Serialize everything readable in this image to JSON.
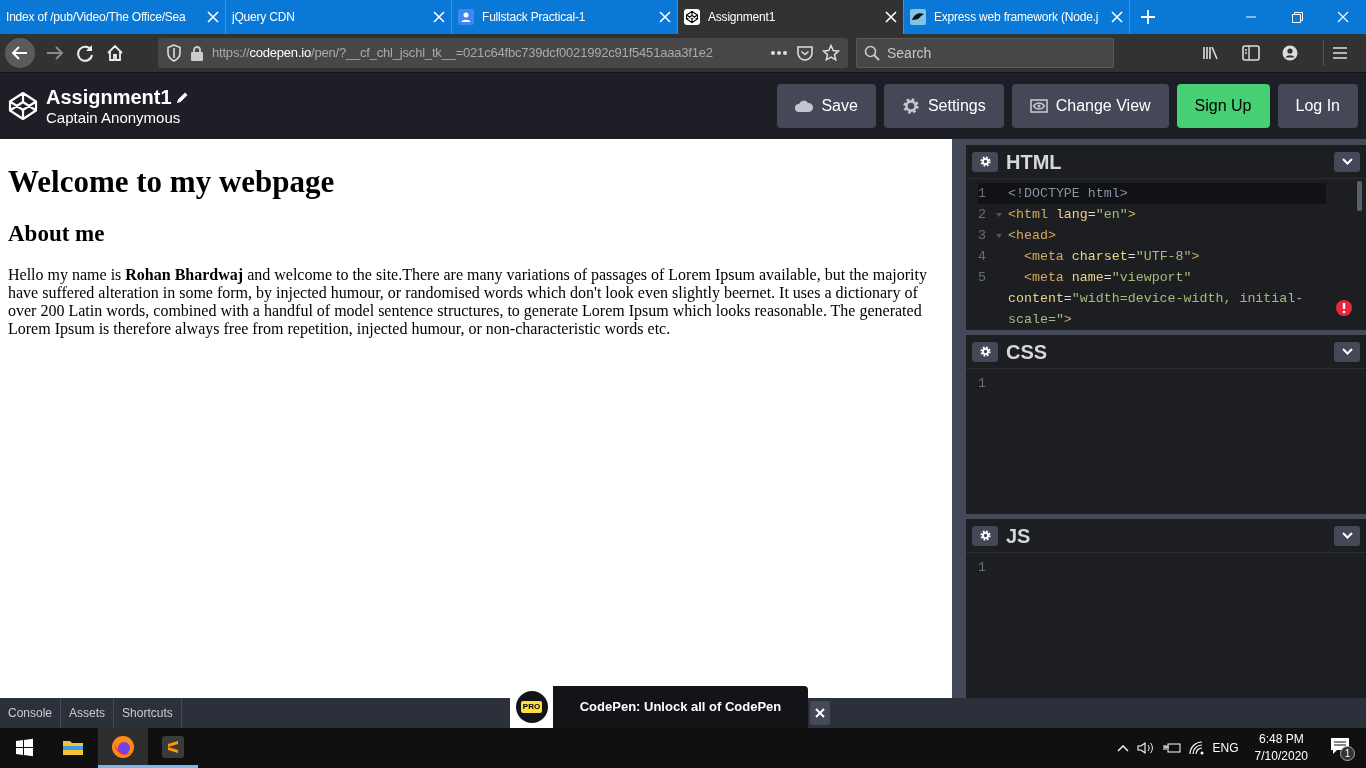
{
  "browser_tabs": [
    {
      "kind": "plain",
      "title": "Index of /pub/Video/The Office/Sea",
      "selected": false
    },
    {
      "kind": "plain",
      "title": "jQuery CDN",
      "selected": false
    },
    {
      "kind": "classroom",
      "title": "Fullstack Practical-1",
      "selected": false
    },
    {
      "kind": "codepen",
      "title": "Assignment1",
      "selected": true
    },
    {
      "kind": "express",
      "title": "Express web framework (Node.j",
      "selected": false
    }
  ],
  "address_bar": {
    "scheme": "https://",
    "domain": "codepen.io",
    "path": "/pen/?__cf_chl_jschl_tk__=021c64fbc739dcf0021992c91f5451aaa3f1e2"
  },
  "search": {
    "placeholder": "Search"
  },
  "pen": {
    "title": "Assignment1",
    "author": "Captain Anonymous"
  },
  "header_buttons": [
    {
      "kind": "cloud",
      "label": "Save",
      "highlighted": false
    },
    {
      "kind": "gear",
      "label": "Settings",
      "highlighted": false
    },
    {
      "kind": "eye",
      "label": "Change View",
      "highlighted": false
    },
    {
      "kind": "none",
      "label": "Sign Up",
      "highlighted": true
    },
    {
      "kind": "none",
      "label": "Log In",
      "highlighted": false
    }
  ],
  "preview": {
    "heading": "Welcome to my webpage",
    "subheading": "About me",
    "paragraph": "Hello my name is **Rohan Bhardwaj** and welcome to the site.There are many variations of passages of Lorem Ipsum available, but the majority have suffered alteration in some form, by injected humour, or randomised words which don't look even slightly beernet. It uses a dictionary of over 200 Latin words, combined with a handful of model sentence structures, to generate Lorem Ipsum which looks reasonable. The generated Lorem Ipsum is therefore always free from repetition, injected humour, or non-characteristic words etc."
  },
  "editors": [
    {
      "title": "HTML",
      "error": true,
      "lines": [
        {
          "number": "1",
          "active": true,
          "foldable": false,
          "tokens": [
            {
              "kind": "doctype",
              "text": "<!DOCTYPE html>"
            }
          ]
        },
        {
          "number": "2",
          "active": false,
          "foldable": true,
          "tokens": [
            {
              "kind": "tag",
              "text": "<html"
            },
            {
              "kind": "attr",
              "text": "lang"
            },
            {
              "kind": "plain",
              "text": "="
            },
            {
              "kind": "value",
              "text": "\"en\""
            },
            {
              "kind": "tag",
              "text": ">"
            }
          ]
        },
        {
          "number": "3",
          "active": false,
          "foldable": true,
          "tokens": [
            {
              "kind": "tag",
              "text": "<head>"
            }
          ]
        },
        {
          "number": "4",
          "active": false,
          "foldable": false,
          "indented": true,
          "tokens": [
            {
              "kind": "tag",
              "text": "<meta"
            },
            {
              "kind": "attr",
              "text": "charset"
            },
            {
              "kind": "plain",
              "text": "="
            },
            {
              "kind": "value",
              "text": "\"UTF-8\""
            },
            {
              "kind": "tag",
              "text": ">"
            }
          ]
        },
        {
          "number": "5",
          "active": false,
          "foldable": false,
          "indented": true,
          "tokens": [
            {
              "kind": "tag",
              "text": "<meta"
            },
            {
              "kind": "attr",
              "text": "name"
            },
            {
              "kind": "plain",
              "text": "="
            },
            {
              "kind": "value",
              "text": "\"viewport\""
            },
            {
              "kind": "attr",
              "text": "content"
            },
            {
              "kind": "plain",
              "text": "="
            },
            {
              "kind": "value",
              "text": "\"width=device-width, initial-scale=\""
            },
            {
              "kind": "tag",
              "text": ">"
            }
          ]
        }
      ]
    },
    {
      "title": "CSS",
      "error": false,
      "lines": [
        {
          "number": "1",
          "active": false,
          "foldable": false
        }
      ]
    },
    {
      "title": "JS",
      "error": false,
      "lines": [
        {
          "number": "1",
          "active": false,
          "foldable": false
        }
      ]
    }
  ],
  "bottom_tabs": [
    "Console",
    "Assets",
    "Shortcuts"
  ],
  "promo": {
    "badge": "PRO",
    "text": "CodePen: Unlock all of CodePen"
  },
  "taskbar": {
    "apps": [
      {
        "kind": "explorer",
        "running": false,
        "selected": false
      },
      {
        "kind": "firefox",
        "running": true,
        "selected": true
      },
      {
        "kind": "sublime",
        "running": true,
        "selected": false
      }
    ],
    "language": "ENG",
    "time": "6:48 PM",
    "date": "7/10/2020",
    "notifications": "1"
  }
}
